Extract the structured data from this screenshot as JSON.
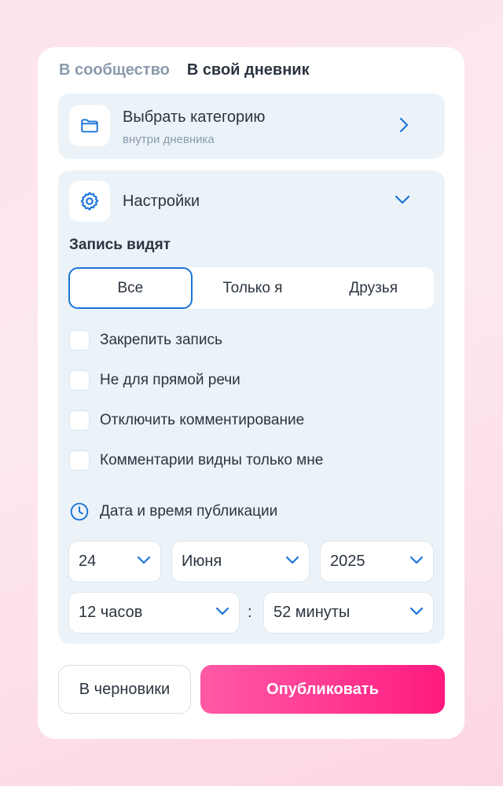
{
  "tabs": [
    {
      "label": "В сообщество",
      "active": false
    },
    {
      "label": "В свой дневник",
      "active": true
    }
  ],
  "category": {
    "title": "Выбрать категорию",
    "subtitle": "внутри дневника",
    "icon": "folder-icon"
  },
  "settings": {
    "title": "Настройки",
    "icon": "gear-icon",
    "visibility_label": "Запись видят",
    "visibility_options": [
      {
        "label": "Все",
        "selected": true
      },
      {
        "label": "Только я",
        "selected": false
      },
      {
        "label": "Друзья",
        "selected": false
      }
    ],
    "checkboxes": [
      {
        "label": "Закрепить запись",
        "checked": false
      },
      {
        "label": "Не для прямой речи",
        "checked": false
      },
      {
        "label": "Отключить комментирование",
        "checked": false
      },
      {
        "label": "Комментарии видны только мне",
        "checked": false
      }
    ],
    "publish_date_label": "Дата и время публикации",
    "date": {
      "day": "24",
      "month": "Июня",
      "year": "2025"
    },
    "time": {
      "hours": "12 часов",
      "separator": ":",
      "minutes": "52 минуты"
    }
  },
  "actions": {
    "draft_label": "В черновики",
    "publish_label": "Опубликовать"
  },
  "colors": {
    "accent": "#1b74d8",
    "publish_gradient_start": "#ff5aa6",
    "publish_gradient_end": "#ff1a80",
    "panel_bg": "#ebf3f8",
    "text": "#2b3440",
    "muted": "#8a9aab"
  }
}
